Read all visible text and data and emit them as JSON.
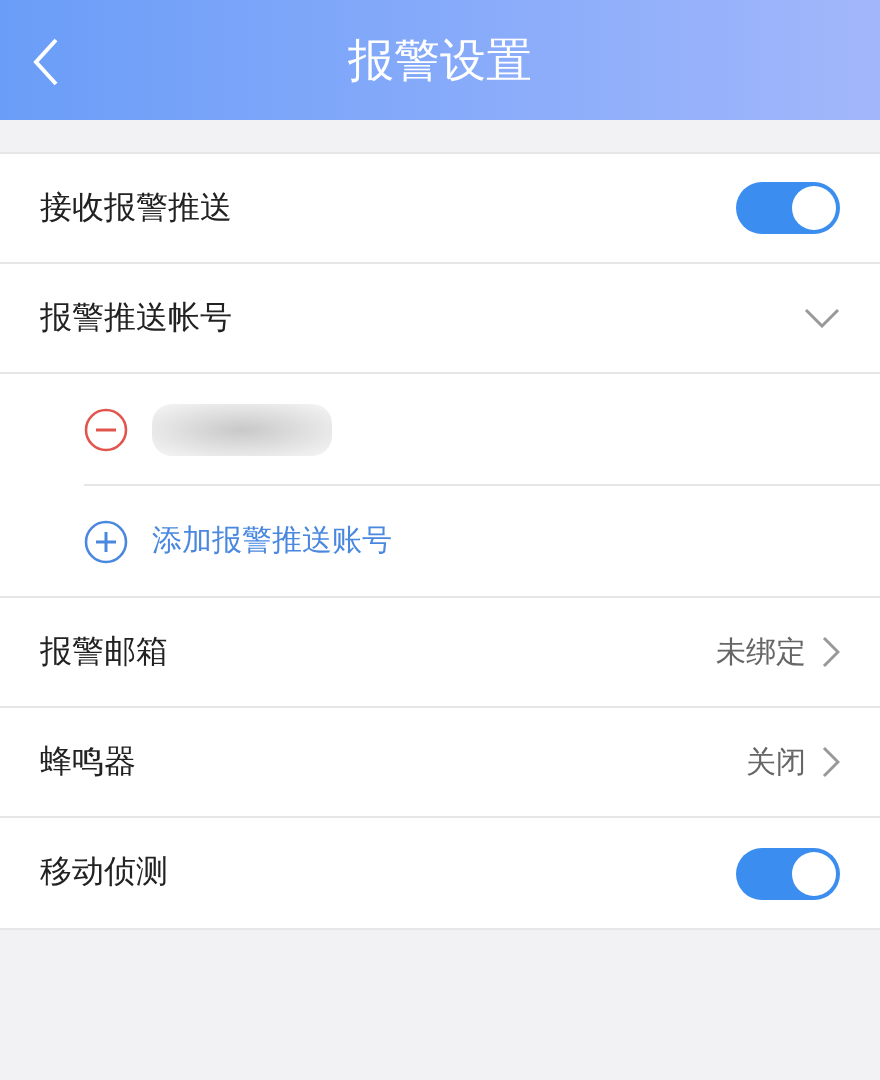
{
  "header": {
    "title": "报警设置"
  },
  "rows": [
    {
      "kind": "toggle",
      "label": "接收报警推送",
      "on": true
    },
    {
      "kind": "expand",
      "label": "报警推送帐号",
      "expanded": true,
      "children": [
        {
          "kind": "account"
        },
        {
          "kind": "add",
          "label": "添加报警推送账号"
        }
      ]
    },
    {
      "kind": "value",
      "label": "报警邮箱",
      "value": "未绑定"
    },
    {
      "kind": "value",
      "label": "蜂鸣器",
      "value": "关闭"
    },
    {
      "kind": "toggle",
      "label": "移动侦测",
      "on": true
    }
  ]
}
